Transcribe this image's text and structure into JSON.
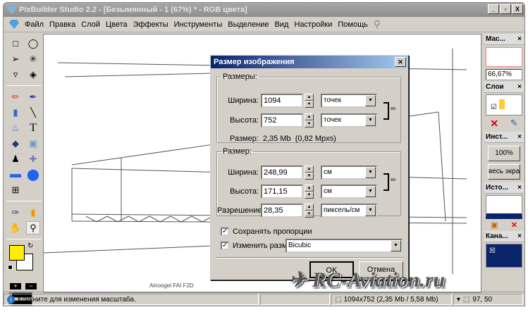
{
  "window": {
    "title": "PixBuilder Studio 2.2 - [Безымянный - 1 (67%) * - RGB цвета]",
    "minimize": "_",
    "restore": "▫",
    "close": "X"
  },
  "menu": [
    "Файл",
    "Правка",
    "Слой",
    "Цвета",
    "Эффекты",
    "Инструменты",
    "Выделение",
    "Вид",
    "Настройки",
    "Помощь"
  ],
  "panels": {
    "navigator": {
      "title": "Мас...",
      "zoom": "66,67%"
    },
    "layers": {
      "title": "Слои"
    },
    "tools": {
      "title": "Инст...",
      "btn_100": "100%",
      "btn_fit": "весь экран"
    },
    "history": {
      "title": "Исто..."
    },
    "channels": {
      "title": "Кана..."
    }
  },
  "canvas": {
    "caption": "Ainoogel FAI F2D"
  },
  "dialog": {
    "title": "Размер изображения",
    "pixel_group": {
      "legend": "Размеры:",
      "width_label": "Ширина:",
      "width": "1094",
      "width_unit": "точек",
      "height_label": "Высота:",
      "height": "752",
      "height_unit": "точек",
      "size_label": "Размер:",
      "size_value": "2,35 Mb  (0,82 Mpxs)"
    },
    "doc_group": {
      "legend": "Размер:",
      "width_label": "Ширина:",
      "width": "248,99",
      "width_unit": "см",
      "height_label": "Высота:",
      "height": "171,15",
      "height_unit": "см",
      "res_label": "Разрешение:",
      "res": "28,35",
      "res_unit": "пиксель/см"
    },
    "keep_proportions": "Сохранять пропорции",
    "resample_label": "Изменить размер:",
    "resample": "Bicubic",
    "ok": "OK",
    "cancel": "Отмена"
  },
  "statusbar": {
    "message": "Кликните для изменения масштаба.",
    "image_info": "1094x752  (2,35 Mb / 5,58 Mb)",
    "coords": "97, 50"
  },
  "toolbox": {
    "layer_plus": "+",
    "layer_minus": "−",
    "slot1": "1",
    "slot2": "2"
  },
  "watermark": "RC-Aviation.ru",
  "colors": {
    "foreground": "#ffee00",
    "background": "#ffffff",
    "dialog_title": "#0a246a"
  }
}
